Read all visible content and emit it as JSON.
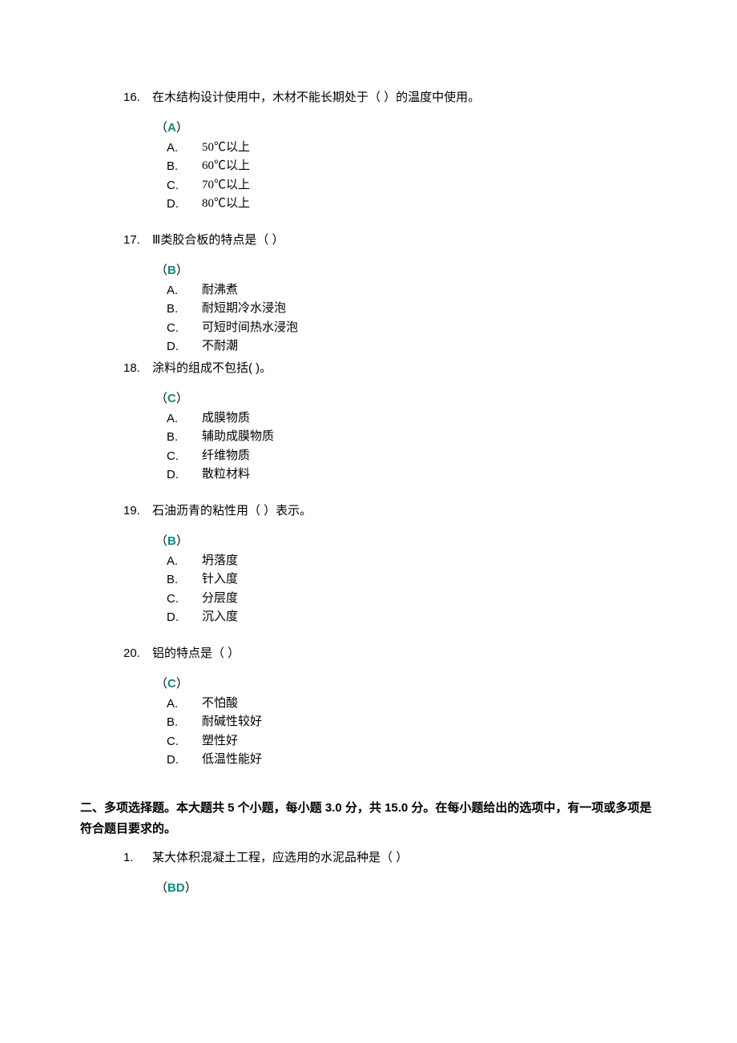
{
  "questions": [
    {
      "num": "16.",
      "text": "在木结构设计使用中，木材不能长期处于（ ）的温度中使用。",
      "answer": "A",
      "options": [
        {
          "letter": "A.",
          "text": "50℃以上"
        },
        {
          "letter": "B.",
          "text": "60℃以上"
        },
        {
          "letter": "C.",
          "text": "70℃以上"
        },
        {
          "letter": "D.",
          "text": "80℃以上"
        }
      ]
    },
    {
      "num": "17.",
      "text": "Ⅲ类胶合板的特点是（ ）",
      "answer": "B",
      "options": [
        {
          "letter": "A.",
          "text": "耐沸煮"
        },
        {
          "letter": "B.",
          "text": "耐短期冷水浸泡"
        },
        {
          "letter": "C.",
          "text": "可短时间热水浸泡"
        },
        {
          "letter": "D.",
          "text": "不耐潮"
        }
      ]
    },
    {
      "num": "18.",
      "text": "涂料的组成不包括(   )。",
      "answer": "C",
      "options": [
        {
          "letter": "A.",
          "text": "成膜物质"
        },
        {
          "letter": "B.",
          "text": "辅助成膜物质"
        },
        {
          "letter": "C.",
          "text": "纤维物质"
        },
        {
          "letter": "D.",
          "text": "散粒材料"
        }
      ]
    },
    {
      "num": "19.",
      "text": "石油沥青的粘性用（  ）表示。",
      "answer": "B",
      "options": [
        {
          "letter": "A.",
          "text": "坍落度"
        },
        {
          "letter": "B.",
          "text": "针入度"
        },
        {
          "letter": "C.",
          "text": "分层度"
        },
        {
          "letter": "D.",
          "text": "沉入度"
        }
      ]
    },
    {
      "num": "20.",
      "text": "铝的特点是（  ）",
      "answer": "C",
      "options": [
        {
          "letter": "A.",
          "text": "不怕酸"
        },
        {
          "letter": "B.",
          "text": "耐碱性较好"
        },
        {
          "letter": "C.",
          "text": "塑性好"
        },
        {
          "letter": "D.",
          "text": "低温性能好"
        }
      ]
    }
  ],
  "section": {
    "prefix": "二、多项选择题。本大题共 ",
    "count": "5",
    "mid1": " 个小题，每小题 ",
    "points": "3.0",
    "mid2": " 分，共 ",
    "total": "15.0",
    "suffix": " 分。在每小题给出的选项中，有一项或多项是符合题目要求的。"
  },
  "multi_questions": [
    {
      "num": "1.",
      "text": "某大体积混凝土工程，应选用的水泥品种是（ ）",
      "answer": "BD"
    }
  ]
}
